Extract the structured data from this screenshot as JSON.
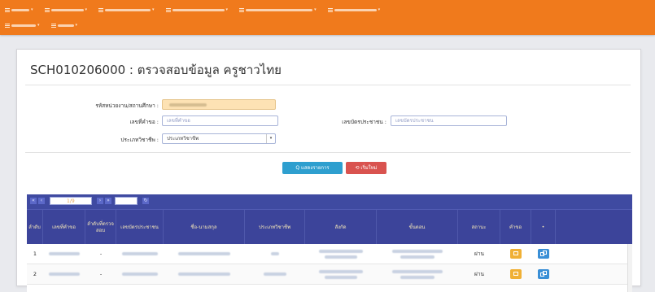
{
  "nav": {
    "items": [
      {
        "label": "",
        "w": 22
      },
      {
        "label": "",
        "w": 40
      },
      {
        "label": "",
        "w": 56
      },
      {
        "label": "",
        "w": 64
      },
      {
        "label": "",
        "w": 82
      },
      {
        "label": "",
        "w": 52
      },
      {
        "label": "",
        "w": 30
      },
      {
        "label": "",
        "w": 20
      }
    ]
  },
  "page": {
    "title": "SCH010206000 : ตรวจสอบข้อมูล ครูชาวไทย"
  },
  "form": {
    "school_code_label": "รหัสหน่วยงาน/สถานศึกษา :",
    "request_no_label": "เลขที่คำขอ :",
    "request_no_placeholder": "เลขที่คำขอ",
    "citizen_id_label": "เลขบัตรประชาชน :",
    "citizen_id_placeholder": "เลขบัตรประชาชน",
    "profession_label": "ประเภทวิชาชีพ :",
    "profession_value": "ประเภทวิชาชีพ",
    "search_button": "Q แสดงรายการ",
    "reset_button": "⟲ เริ่มใหม่"
  },
  "pager": {
    "page_value": "1/9"
  },
  "table": {
    "headers": [
      "ลำดับ",
      "เลขที่คำขอ",
      "ลำดับที่ตรวจสอบ",
      "เลขบัตรประชาชน",
      "ชื่อ-นามสกุล",
      "ประเภทวิชาชีพ",
      "สังกัด",
      "ขั้นตอน",
      "สถานะ",
      "คำขอ",
      "•"
    ],
    "rows": [
      {
        "no": "1",
        "check_order": "-",
        "status": "ผ่าน"
      },
      {
        "no": "2",
        "check_order": "-",
        "status": "ผ่าน"
      }
    ]
  }
}
